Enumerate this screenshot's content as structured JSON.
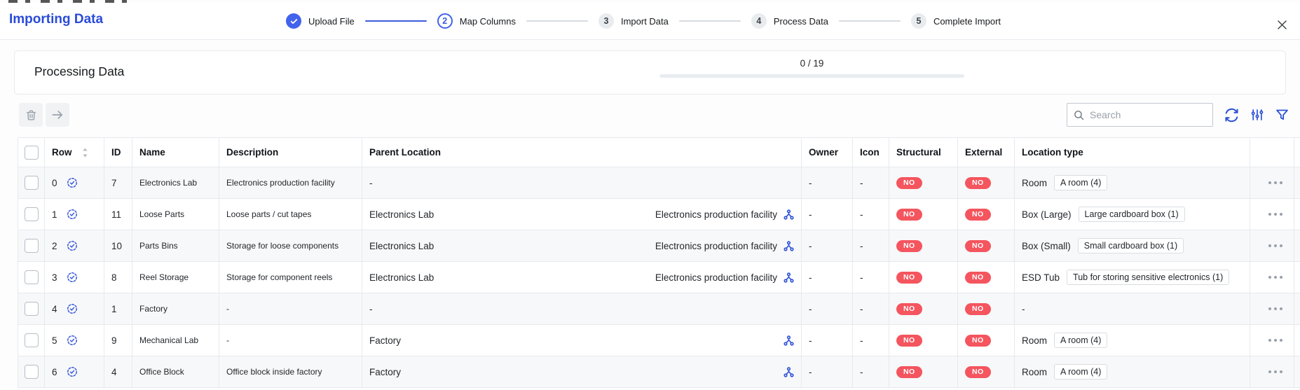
{
  "header": {
    "title": "Importing Data",
    "steps": [
      {
        "label": "Upload File",
        "state": "done",
        "number": ""
      },
      {
        "label": "Map Columns",
        "state": "active",
        "number": "2"
      },
      {
        "label": "Import Data",
        "state": "pending",
        "number": "3"
      },
      {
        "label": "Process Data",
        "state": "pending",
        "number": "4"
      },
      {
        "label": "Complete Import",
        "state": "pending",
        "number": "5"
      }
    ]
  },
  "processing": {
    "title": "Processing Data",
    "progress_text": "0 / 19",
    "progress_value": 0,
    "progress_max": 19
  },
  "toolbar": {
    "search_placeholder": "Search"
  },
  "colors": {
    "accent_blue": "#2b4fd6",
    "badge_red": "#f4555e",
    "disabled_icon_gray": "#9aa3ad"
  },
  "table": {
    "columns": [
      "",
      "Row",
      "ID",
      "Name",
      "Description",
      "Parent Location",
      "Owner",
      "Icon",
      "Structural",
      "External",
      "Location type",
      "",
      ""
    ],
    "rows": [
      {
        "row": "0",
        "id": "7",
        "name": "Electronics Lab",
        "description": "Electronics production facility",
        "parent_left": "-",
        "parent_right": "",
        "parent_icon": false,
        "owner": "-",
        "icon": "-",
        "structural": "NO",
        "external": "NO",
        "loc_type": "Room",
        "loc_chip": "A room (4)"
      },
      {
        "row": "1",
        "id": "11",
        "name": "Loose Parts",
        "description": "Loose parts / cut tapes",
        "parent_left": "Electronics Lab",
        "parent_right": "Electronics production facility",
        "parent_icon": true,
        "owner": "-",
        "icon": "-",
        "structural": "NO",
        "external": "NO",
        "loc_type": "Box (Large)",
        "loc_chip": "Large cardboard box (1)"
      },
      {
        "row": "2",
        "id": "10",
        "name": "Parts Bins",
        "description": "Storage for loose components",
        "parent_left": "Electronics Lab",
        "parent_right": "Electronics production facility",
        "parent_icon": true,
        "owner": "-",
        "icon": "-",
        "structural": "NO",
        "external": "NO",
        "loc_type": "Box (Small)",
        "loc_chip": "Small cardboard box (1)"
      },
      {
        "row": "3",
        "id": "8",
        "name": "Reel Storage",
        "description": "Storage for component reels",
        "parent_left": "Electronics Lab",
        "parent_right": "Electronics production facility",
        "parent_icon": true,
        "owner": "-",
        "icon": "-",
        "structural": "NO",
        "external": "NO",
        "loc_type": "ESD Tub",
        "loc_chip": "Tub for storing sensitive electronics (1)"
      },
      {
        "row": "4",
        "id": "1",
        "name": "Factory",
        "description": "-",
        "parent_left": "-",
        "parent_right": "",
        "parent_icon": false,
        "owner": "-",
        "icon": "-",
        "structural": "NO",
        "external": "NO",
        "loc_type": "-",
        "loc_chip": null
      },
      {
        "row": "5",
        "id": "9",
        "name": "Mechanical Lab",
        "description": "-",
        "parent_left": "Factory",
        "parent_right": "",
        "parent_icon": true,
        "owner": "-",
        "icon": "-",
        "structural": "NO",
        "external": "NO",
        "loc_type": "Room",
        "loc_chip": "A room (4)"
      },
      {
        "row": "6",
        "id": "4",
        "name": "Office Block",
        "description": "Office block inside factory",
        "parent_left": "Factory",
        "parent_right": "",
        "parent_icon": true,
        "owner": "-",
        "icon": "-",
        "structural": "NO",
        "external": "NO",
        "loc_type": "Room",
        "loc_chip": "A room (4)"
      }
    ]
  }
}
